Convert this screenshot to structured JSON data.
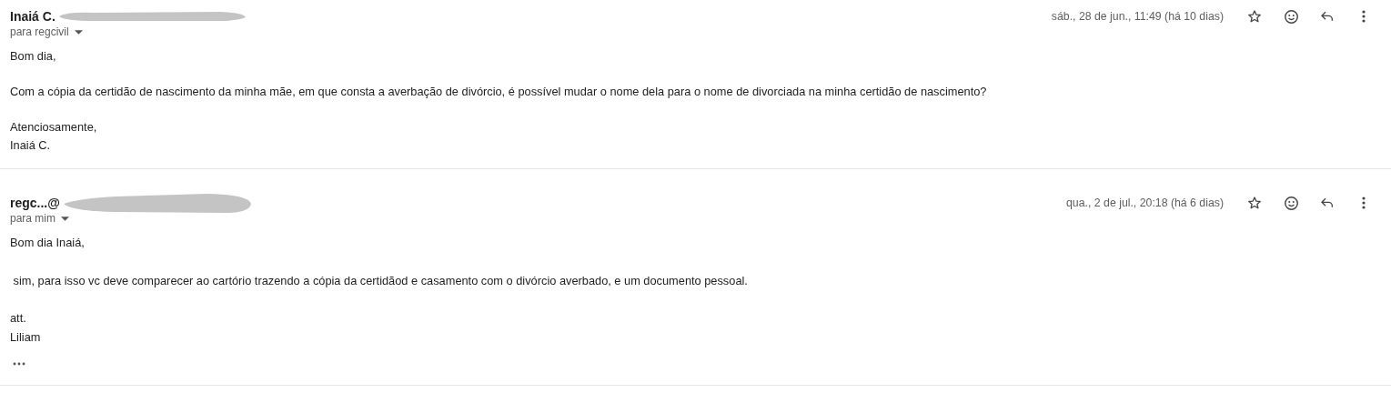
{
  "messages": [
    {
      "sender": "Inaiá C.",
      "recipient": "para regcivil",
      "date": "sáb., 28 de jun., 11:49 (há 10 dias)",
      "starred": false,
      "paragraphs": [
        "Bom dia,",
        "Com a cópia da certidão de nascimento da minha mãe, em que consta a averbação de divórcio, é possível mudar o nome dela para o nome de divorciada na minha certidão de nascimento?",
        "Atenciosamente,\nInaiá C."
      ],
      "trimmed_content": false
    },
    {
      "sender": "regc...@",
      "recipient": "para mim",
      "date": "qua., 2 de jul., 20:18 (há 6 dias)",
      "starred": false,
      "paragraphs": [
        "Bom dia Inaiá,",
        " sim, para isso vc deve comparecer ao cartório trazendo a cópia da certidãod e casamento com o divórcio averbado, e um documento pessoal.",
        "att.\nLiliam"
      ],
      "trimmed_content": true
    }
  ]
}
